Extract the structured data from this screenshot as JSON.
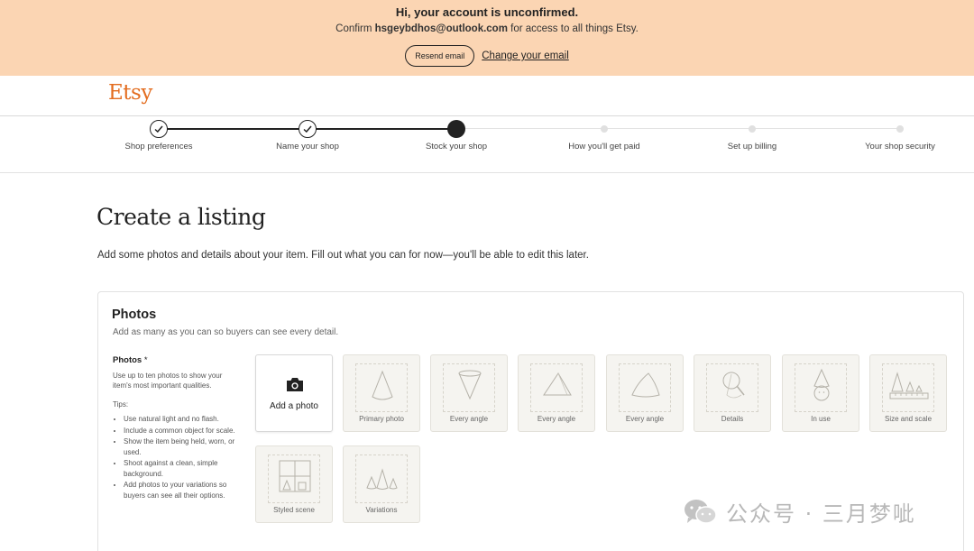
{
  "banner": {
    "title": "Hi, your account is unconfirmed.",
    "msg_prefix": "Confirm",
    "email": "hsgeybdhos@outlook.com",
    "msg_suffix": "for access to all things Etsy.",
    "resend_label": "Resend email",
    "change_label": "Change your email"
  },
  "header": {
    "logo": "Etsy"
  },
  "stepper": {
    "steps": [
      {
        "label": "Shop preferences",
        "state": "done"
      },
      {
        "label": "Name your shop",
        "state": "done"
      },
      {
        "label": "Stock your shop",
        "state": "current"
      },
      {
        "label": "How you'll get paid",
        "state": "todo"
      },
      {
        "label": "Set up billing",
        "state": "todo"
      },
      {
        "label": "Your shop security",
        "state": "todo"
      }
    ]
  },
  "page": {
    "title": "Create a listing",
    "subtitle": "Add some photos and details about your item. Fill out what you can for now—you'll be able to edit this later."
  },
  "photos": {
    "title": "Photos",
    "subtitle": "Add as many as you can so buyers can see every detail.",
    "side_head": "Photos",
    "side_star": "*",
    "side_desc": "Use up to ten photos to show your item's most important qualities.",
    "tips_label": "Tips:",
    "tips": [
      "Use natural light and no flash.",
      "Include a common object for scale.",
      "Show the item being held, worn, or used.",
      "Shoot against a clean, simple background.",
      "Add photos to your variations so buyers can see all their options."
    ],
    "add_label": "Add a photo",
    "slots": [
      "Primary photo",
      "Every angle",
      "Every angle",
      "Every angle",
      "Details",
      "In use",
      "Size and scale",
      "Styled scene",
      "Variations"
    ]
  },
  "watermark": {
    "text": "公众号 · 三月梦呲"
  },
  "colors": {
    "banner_bg": "#fbd5b3",
    "brand": "#e36d20",
    "tile_bg": "#f5f4f0"
  }
}
